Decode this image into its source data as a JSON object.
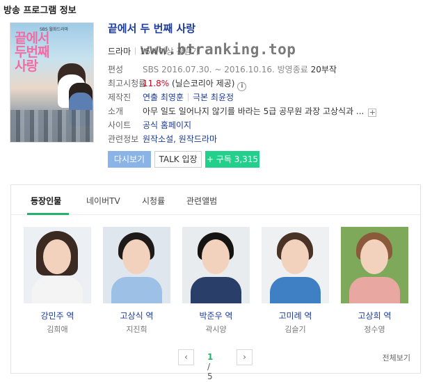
{
  "section_title": "방송 프로그램 정보",
  "poster": {
    "badge_text": "SBS 월화드라마",
    "title_text": "끝에서 두번째 사랑"
  },
  "drama": {
    "title": "끝에서 두 번째 사랑",
    "genre": "드라마",
    "rating_age": "15세이상 관람가",
    "schedule_label": "편성",
    "schedule_value": "SBS 2016.07.30. ~ 2016.10.16.",
    "schedule_status": "방영종료",
    "episodes": "20부작",
    "top_rating_label": "최고시청률",
    "top_rating_value": "11.8%",
    "top_rating_source": "(닐슨코리아 제공)",
    "staff_label": "제작진",
    "director": "연출 최영훈",
    "writer": "극본 최윤정",
    "intro_label": "소개",
    "intro_text": "아무 일도 일어나지 않기를 바라는 5급 공무원 과장 고상식과 ...",
    "site_label": "사이트",
    "site_value": "공식 홈페이지",
    "related_label": "관련정보",
    "related_value": "원작소설, 원작드라마"
  },
  "watermark": "www.btranking.top",
  "buttons": {
    "rewatch": "다시보기",
    "talk": "TALK 입장",
    "subscribe": "+ 구독 3,315"
  },
  "tabs": [
    {
      "label": "등장인물",
      "active": true
    },
    {
      "label": "네이버TV",
      "active": false
    },
    {
      "label": "시청률",
      "active": false
    },
    {
      "label": "관련앨범",
      "active": false
    }
  ],
  "cast": [
    {
      "role": "강민주 역",
      "actor": "김희애"
    },
    {
      "role": "고상식 역",
      "actor": "지진희"
    },
    {
      "role": "박준우 역",
      "actor": "곽시양"
    },
    {
      "role": "고미례 역",
      "actor": "김슬기"
    },
    {
      "role": "고상희 역",
      "actor": "정수영"
    }
  ],
  "pager": {
    "current": "1",
    "total": "/ 5",
    "prev_icon": "chevron-left-icon",
    "next_icon": "chevron-right-icon"
  },
  "view_all": "전체보기",
  "colors": {
    "accent_green": "#22b26a",
    "title_blue": "#1a3b9c",
    "rating_red": "#d9001b",
    "rewatch_blue": "#8ab4e8",
    "subscribe_green": "#22d08c"
  }
}
